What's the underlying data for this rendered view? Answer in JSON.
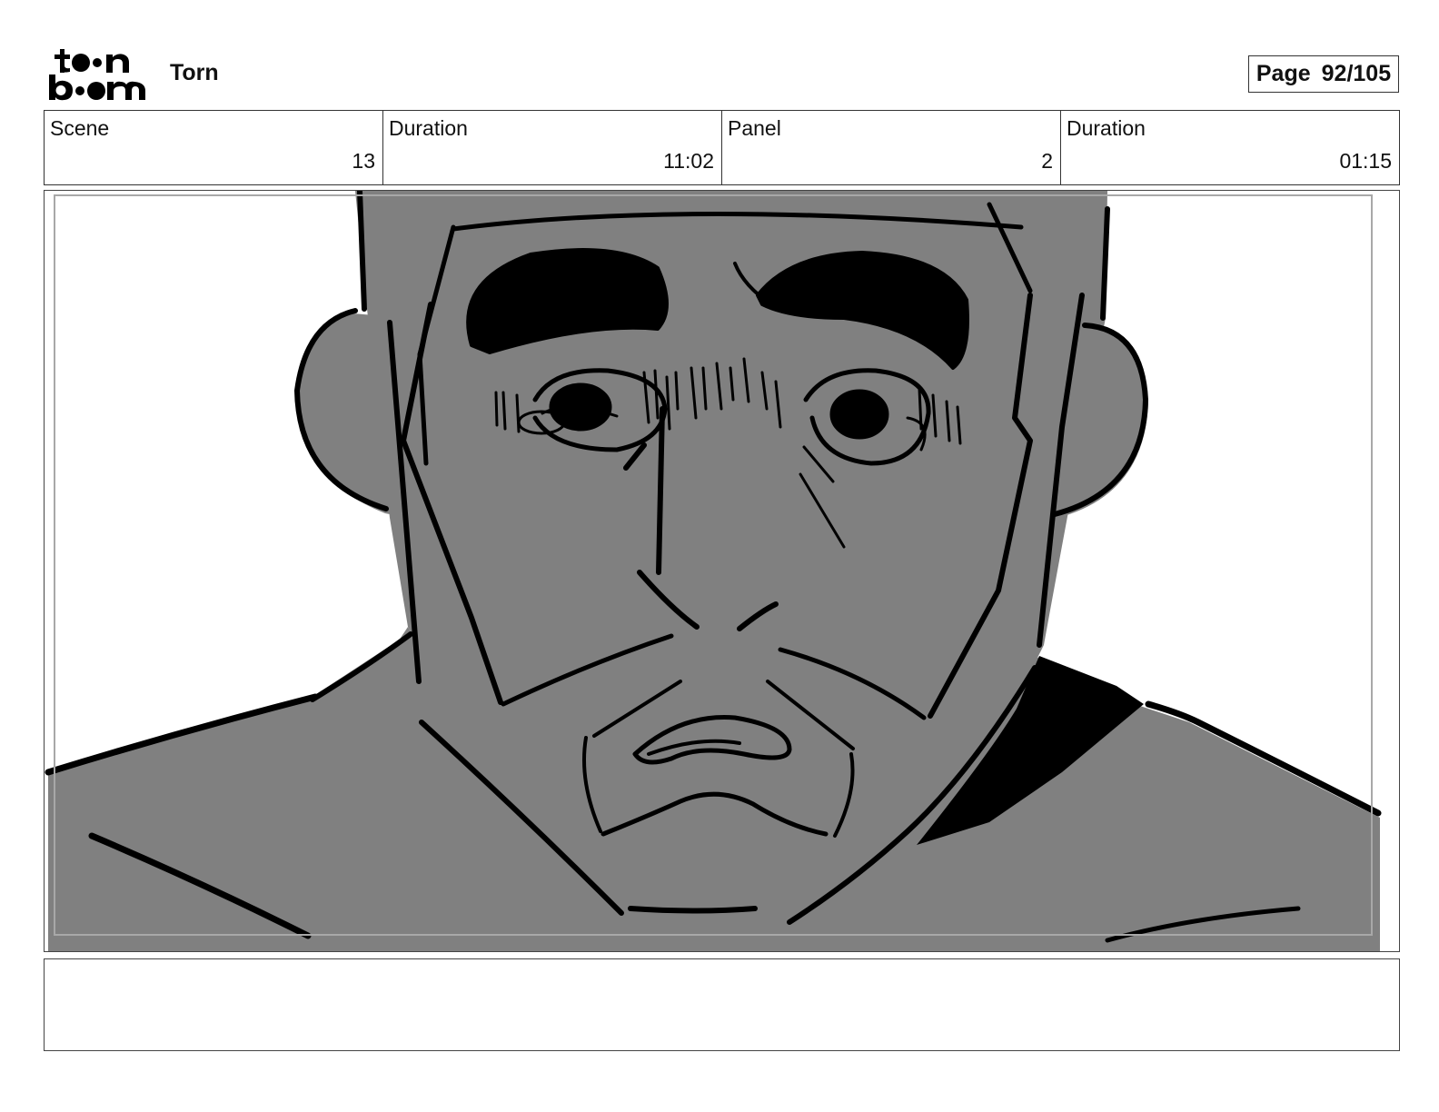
{
  "header": {
    "logo_text": "toon boom",
    "project_title": "Torn",
    "page_label": "Page",
    "page_number": "92/105"
  },
  "info": [
    {
      "label": "Scene",
      "value": "13"
    },
    {
      "label": "Duration",
      "value": "11:02"
    },
    {
      "label": "Panel",
      "value": "2"
    },
    {
      "label": "Duration",
      "value": "01:15"
    }
  ],
  "colors": {
    "skin_fill": "#808080",
    "ink": "#000000",
    "border": "#333333"
  },
  "caption": {
    "text": ""
  }
}
